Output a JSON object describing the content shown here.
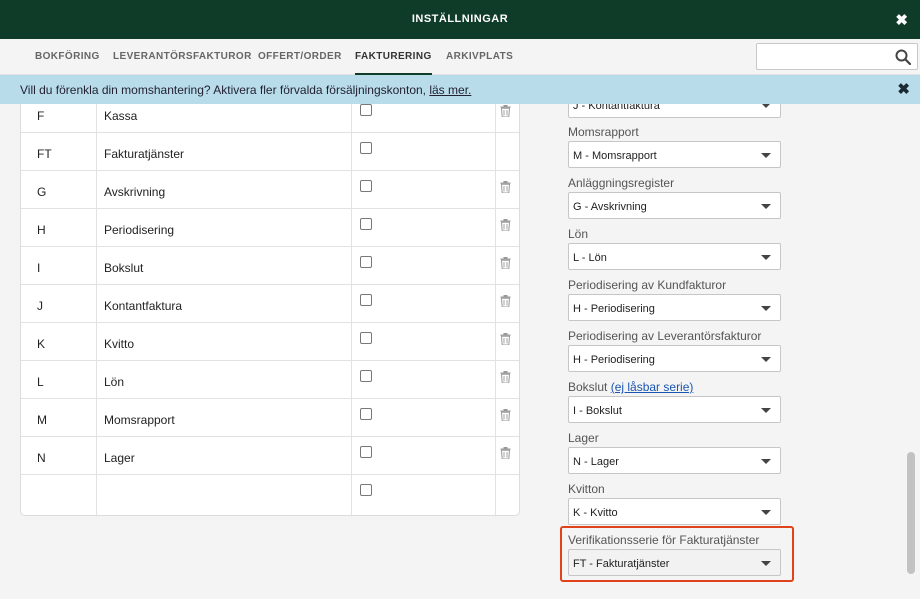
{
  "window": {
    "title": "INSTÄLLNINGAR",
    "close_glyph": "✖"
  },
  "tabs": [
    {
      "label": "BOKFÖRING",
      "active": false
    },
    {
      "label": "LEVERANTÖRSFAKTUROR",
      "active": false
    },
    {
      "label": "OFFERT/ORDER",
      "active": false
    },
    {
      "label": "FAKTURERING",
      "active": true
    },
    {
      "label": "ARKIVPLATS",
      "active": false
    }
  ],
  "search": {
    "placeholder": "",
    "value": "",
    "icon": "search-icon"
  },
  "banner": {
    "text": "Vill du förenkla din momshantering? Aktivera fler förvalda försäljningskonton, ",
    "link": "läs mer.",
    "close_glyph": "✖",
    "background": "#b9dcea"
  },
  "series_table": {
    "rows": [
      {
        "code": "F",
        "name": "Kassa",
        "checked": false,
        "deletable": true
      },
      {
        "code": "FT",
        "name": "Fakturatjänster",
        "checked": false,
        "deletable": false
      },
      {
        "code": "G",
        "name": "Avskrivning",
        "checked": false,
        "deletable": true
      },
      {
        "code": "H",
        "name": "Periodisering",
        "checked": false,
        "deletable": true
      },
      {
        "code": "I",
        "name": "Bokslut",
        "checked": false,
        "deletable": true
      },
      {
        "code": "J",
        "name": "Kontantfaktura",
        "checked": false,
        "deletable": true
      },
      {
        "code": "K",
        "name": "Kvitto",
        "checked": false,
        "deletable": true
      },
      {
        "code": "L",
        "name": "Lön",
        "checked": false,
        "deletable": true
      },
      {
        "code": "M",
        "name": "Momsrapport",
        "checked": false,
        "deletable": true
      },
      {
        "code": "N",
        "name": "Lager",
        "checked": false,
        "deletable": true
      },
      {
        "code": "",
        "name": "",
        "checked": false,
        "deletable": false
      }
    ]
  },
  "series_settings": {
    "partial_top_select": "J - Kontantfaktura",
    "fields": [
      {
        "label": "Momsrapport",
        "value": "M - Momsrapport"
      },
      {
        "label": "Anläggningsregister",
        "value": "G - Avskrivning"
      },
      {
        "label": "Lön",
        "value": "L - Lön"
      },
      {
        "label": "Periodisering av Kundfakturor",
        "value": "H - Periodisering"
      },
      {
        "label": "Periodisering av Leverantörsfakturor",
        "value": "H - Periodisering"
      },
      {
        "label": "Bokslut",
        "link": "(ej låsbar serie)",
        "value": "I - Bokslut"
      },
      {
        "label": "Lager",
        "value": "N - Lager"
      },
      {
        "label": "Kvitton",
        "value": "K - Kvitto"
      },
      {
        "label": "Verifikationsserie för Fakturatjänster",
        "value": "FT - Fakturatjänster",
        "highlighted": true
      }
    ]
  },
  "colors": {
    "header": "#0f3b29",
    "highlight": "#e0421c",
    "link": "#1a56b0"
  }
}
